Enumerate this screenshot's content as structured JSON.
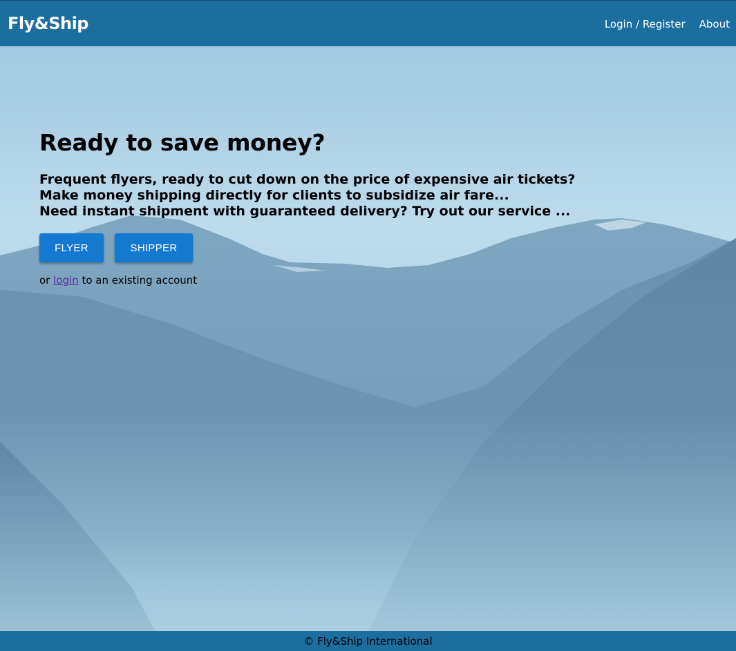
{
  "header": {
    "brand": "Fly&Ship",
    "nav": {
      "login_register": "Login / Register",
      "about": "About"
    }
  },
  "hero": {
    "title": "Ready to save money?",
    "lines": [
      "Frequent flyers, ready to cut down on the price of expensive air tickets?",
      "Make money shipping directly for clients to subsidize air fare...",
      "Need instant shipment with guaranteed delivery? Try out our service ..."
    ],
    "buttons": {
      "flyer": "FLYER",
      "shipper": "SHIPPER"
    },
    "login_prefix": "or",
    "login_link": "login",
    "login_suffix": "to an existing account"
  },
  "footer": {
    "text": "© Fly&Ship International"
  },
  "colors": {
    "navbar": "#1c6e9e",
    "button": "#1479d1",
    "link_visited": "#5b2aa3"
  }
}
